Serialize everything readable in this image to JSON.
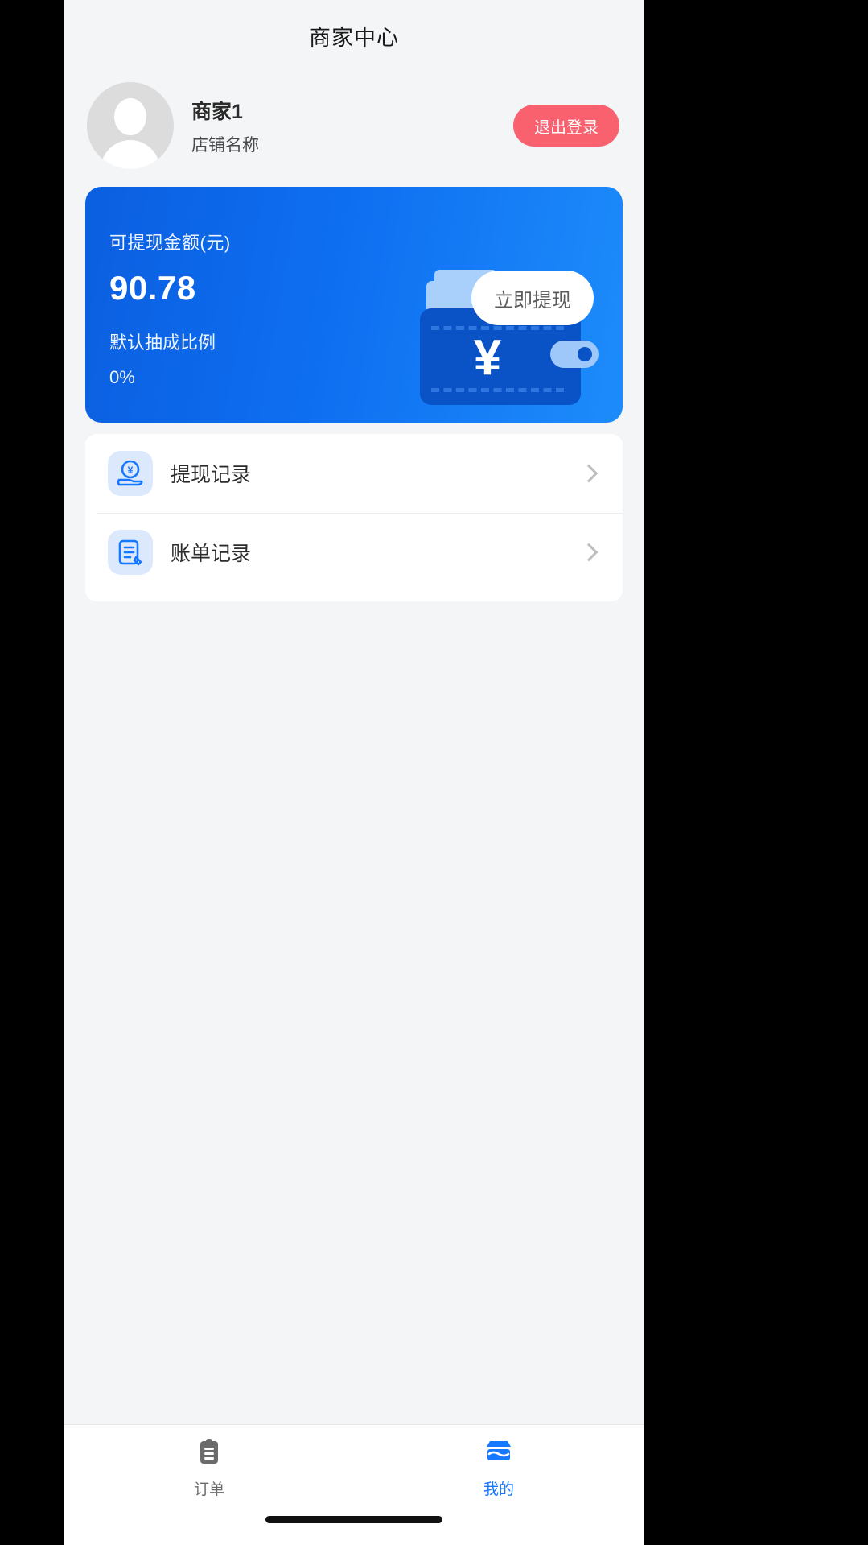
{
  "header": {
    "title": "商家中心"
  },
  "profile": {
    "merchant_name": "商家1",
    "shop_name": "店铺名称",
    "logout_label": "退出登录",
    "avatar_icon": "user-avatar-placeholder-icon"
  },
  "balance_card": {
    "balance_label": "可提现金额(元)",
    "balance_value": "90.78",
    "rate_label": "默认抽成比例",
    "rate_value": "0%",
    "withdraw_label": "立即提现",
    "wallet_icon": "wallet-yen-icon",
    "gradient_from": "#0b5fe0",
    "gradient_to": "#1d8cfb"
  },
  "menu": {
    "items": [
      {
        "label": "提现记录",
        "icon": "hand-yen-coin-icon"
      },
      {
        "label": "账单记录",
        "icon": "bill-document-icon"
      }
    ],
    "chevron_icon": "chevron-right-icon"
  },
  "tabbar": {
    "items": [
      {
        "label": "订单",
        "icon": "clipboard-order-icon",
        "active": false
      },
      {
        "label": "我的",
        "icon": "store-shop-icon",
        "active": true
      }
    ],
    "active_color": "#1677ff",
    "inactive_color": "#6b6b6b"
  }
}
